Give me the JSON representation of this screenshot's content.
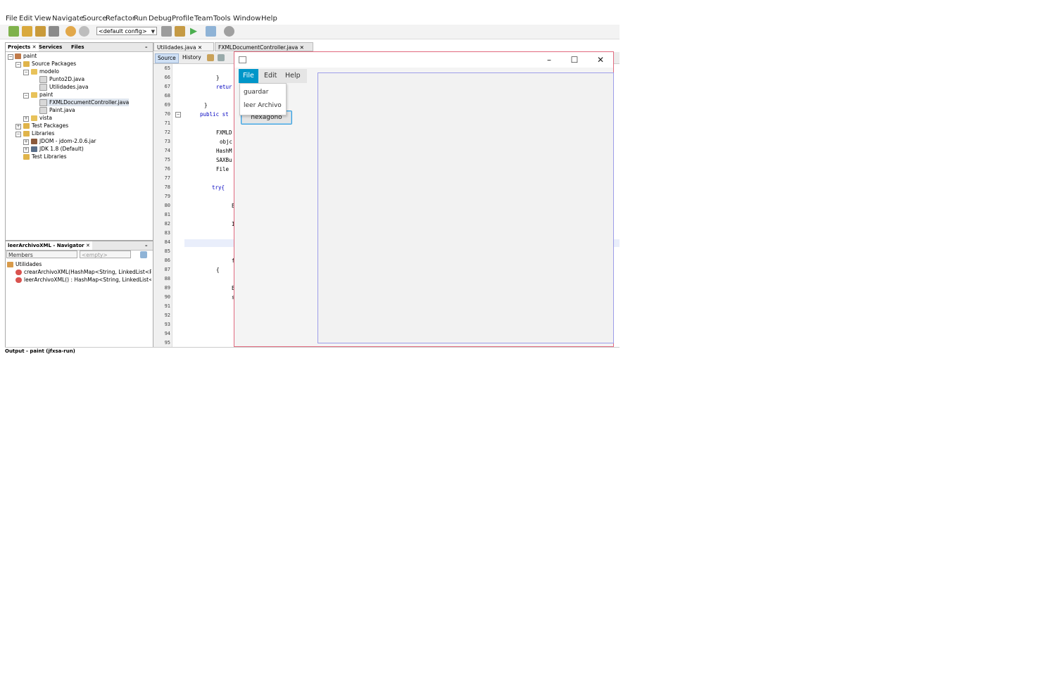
{
  "ide": {
    "menu": [
      "File",
      "Edit",
      "View",
      "Navigate",
      "Source",
      "Refactor",
      "Run",
      "Debug",
      "Profile",
      "Team",
      "Tools",
      "Window",
      "Help"
    ],
    "toolbar": {
      "config": "<default config>"
    },
    "projects": {
      "tabs": [
        "Projects",
        "Services",
        "Files"
      ],
      "tree": [
        "paint",
        "Source Packages",
        "modelo",
        "Punto2D.java",
        "Utilidades.java",
        "paint",
        "FXMLDocumentController.java",
        "Paint.java",
        "vista",
        "Test Packages",
        "Libraries",
        "JDOM - jdom-2.0.6.jar",
        "JDK 1.8 (Default)",
        "Test Libraries"
      ]
    },
    "navigator": {
      "title": "leerArchivoXML - Navigator",
      "filter": "Members",
      "empty": "<empty>",
      "items": [
        "Utilidades",
        "crearArchivoXML(HashMap<String, LinkedList<Pun",
        "leerArchivoXML() : HashMap<String, LinkedList<Pu"
      ]
    },
    "editor": {
      "tabs": [
        "Utilidades.java",
        "FXMLDocumentController.java"
      ],
      "source_tab": "Source",
      "history_tab": "History",
      "line_numbers": [
        "65",
        "66",
        "67",
        "68",
        "69",
        "70",
        "71",
        "72",
        "73",
        "74",
        "75",
        "76",
        "77",
        "78",
        "79",
        "80",
        "81",
        "82",
        "83",
        "84",
        "85",
        "86",
        "87",
        "88",
        "89",
        "90",
        "91",
        "92",
        "93",
        "94",
        "95"
      ],
      "code": {
        "l66": "}",
        "l67": "retur",
        "l69": "}",
        "l70": "public st",
        "l72": "FXMLD",
        "l73": "objc",
        "l74": "HashM",
        "l75": "SAXBu",
        "l76": "File",
        "l78": "try{",
        "l80": "E",
        "l82": "I",
        "l86": "f",
        "l87": "{",
        "l89": "E",
        "l90": "s"
      }
    },
    "output": "Output - paint (jfxsa-run)"
  },
  "app": {
    "window": {
      "minimize": "–",
      "maximize": "☐",
      "close": "✕"
    },
    "menus": [
      "File",
      "Edit",
      "Help"
    ],
    "file_menu_items": [
      "guardar",
      "leer Archivo"
    ],
    "button": "hexagono"
  },
  "colors": {
    "accent": "#0096c9",
    "window_border": "#e06a7e",
    "canvas_border": "#9d9de8"
  }
}
